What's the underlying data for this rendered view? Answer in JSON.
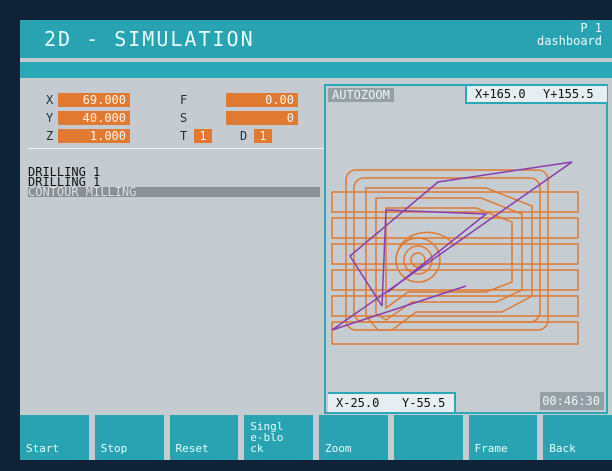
{
  "title": "2D - SIMULATION",
  "page": {
    "number": "P 1",
    "name": "dashboard"
  },
  "axes": {
    "x": {
      "label": "X",
      "value": "69.000"
    },
    "y": {
      "label": "Y",
      "value": "40.000"
    },
    "z": {
      "label": "Z",
      "value": "1.000"
    },
    "f": {
      "label": "F",
      "value": "0.00"
    },
    "s": {
      "label": "S",
      "value": "0"
    },
    "t": {
      "label": "T",
      "value": "1"
    },
    "d": {
      "label": "D",
      "value": "1"
    }
  },
  "program": [
    "DRILLING 1",
    "DRILLING 1",
    "CONTOUR MILLING"
  ],
  "simulation": {
    "mode": "AUTOZOOM",
    "coords_top": {
      "x": "X+165.0",
      "y": "Y+155.5"
    },
    "coords_bottom": {
      "x": "X-25.0",
      "y": "Y-55.5"
    },
    "timer": "00:46:30"
  },
  "softkeys": [
    "Start",
    "Stop",
    "Reset",
    "Single-block",
    "Zoom",
    "",
    "Frame",
    "Back"
  ],
  "colors": {
    "accent": "#29a3b2",
    "panel": "#c4ccd1",
    "value_bg": "#e07a33",
    "toolpath": "#e07a33",
    "path_secondary": "#8a3db0"
  }
}
